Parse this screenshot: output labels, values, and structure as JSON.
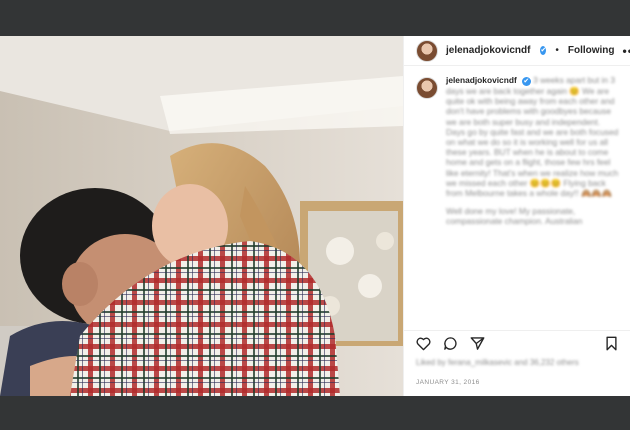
{
  "header": {
    "username": "jelenadjokovicndf",
    "verified": "✔",
    "separator": "•",
    "follow_label": "Following",
    "more_label": "•••"
  },
  "caption": {
    "username": "jelenadjokovicndf",
    "verified": "✔",
    "text": "3 weeks apart but in 3 days we are back together again 😊 We are quite ok with being away from each other and don't have problems with goodbyes because we are both super busy and independent. Days go by quite fast and we are both focused on what we do so it is working well for us all these years. BUT when he is about to come home and gets on a flight, those few hrs feel like eternity! That's when we realize how much we missed each other 😊😊😊 Flying back from Melbourne takes a whole day!! 🙈🙈🙈",
    "text2": "Well done my love! My passionate, compassionate champion. Australian"
  },
  "actions": {
    "like_icon": "heart-outline-icon",
    "comment_icon": "comment-bubble-icon",
    "share_icon": "paper-plane-icon",
    "save_icon": "bookmark-icon"
  },
  "likes_text": "Liked by ferana_milkasevic and 36,232 others",
  "date": "JANUARY 31, 2016",
  "colors": {
    "page_background": "#333536",
    "panel_background": "#ffffff",
    "verified_badge": "#3897f0",
    "text_primary": "#262626",
    "text_secondary": "#8e8e8e"
  }
}
